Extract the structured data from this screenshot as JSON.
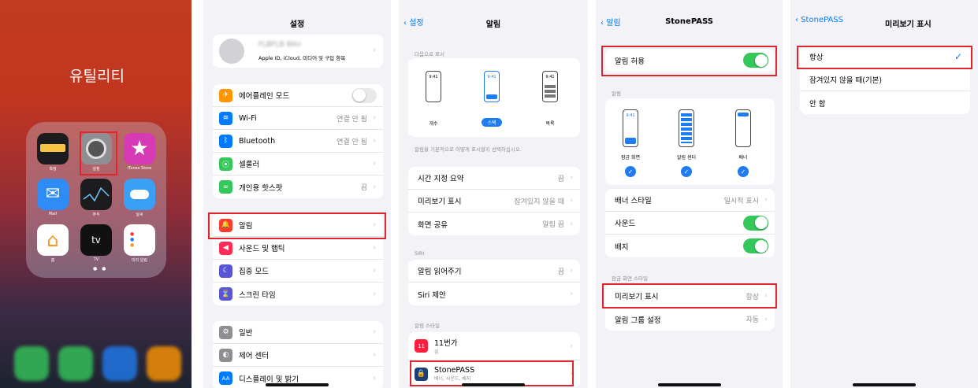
{
  "home": {
    "folder_title": "유틸리티",
    "apps": [
      "측정",
      "설정",
      "iTunes Store",
      "Mail",
      "주식",
      "날씨",
      "홈",
      "TV",
      "미리 알림"
    ],
    "tv_text": "tv"
  },
  "settings": {
    "title": "설정",
    "account_name": "FLBFLB BIIU",
    "account_sub": "Apple ID, iCloud, 미디어 및 구입 항목",
    "group1": [
      {
        "label": "에어플레인 모드",
        "value": ""
      },
      {
        "label": "Wi-Fi",
        "value": "연결 안 됨"
      },
      {
        "label": "Bluetooth",
        "value": "연결 안 됨"
      },
      {
        "label": "셀룰러",
        "value": ""
      },
      {
        "label": "개인용 핫스팟",
        "value": "끔"
      }
    ],
    "group2": [
      {
        "label": "알림"
      },
      {
        "label": "사운드 및 햅틱"
      },
      {
        "label": "집중 모드"
      },
      {
        "label": "스크린 타임"
      }
    ],
    "group3": [
      {
        "label": "일반"
      },
      {
        "label": "제어 센터"
      },
      {
        "label": "디스플레이 및 밝기"
      }
    ]
  },
  "notifications": {
    "back": "설정",
    "title": "알림",
    "section_display": "다음으로 표시",
    "styles": [
      "개수",
      "스택",
      "목록"
    ],
    "time": "9:41",
    "desc": "알림을 기본적으로 어떻게 표시할지 선택하십시오.",
    "rows": [
      {
        "label": "시간 지정 요약",
        "value": "끔"
      },
      {
        "label": "미리보기 표시",
        "value": "잠겨있지 않을 때"
      },
      {
        "label": "화면 공유",
        "value": "알림 끔"
      }
    ],
    "siri_header": "SIRI",
    "siri_rows": [
      {
        "label": "알림 읽어주기",
        "value": "끔"
      },
      {
        "label": "Siri 제안",
        "value": ""
      }
    ],
    "style_header": "알림 스타일",
    "apps": [
      {
        "name": "11번가",
        "sub": "끔",
        "icon": "11"
      },
      {
        "name": "StonePASS",
        "sub": "배너, 사운드, 배지"
      }
    ]
  },
  "stonepass": {
    "back": "알림",
    "title": "StonePASS",
    "allow": "알림 허용",
    "alert_header": "알림",
    "positions": [
      "잠금 화면",
      "알림 센터",
      "배너"
    ],
    "time": "9:41",
    "rows": [
      {
        "label": "배너 스타일",
        "value": "일시적 표시"
      },
      {
        "label": "사운드",
        "value": ""
      },
      {
        "label": "배지",
        "value": ""
      }
    ],
    "lock_header": "잠금 화면 스타일",
    "lock_rows": [
      {
        "label": "미리보기 표시",
        "value": "항상"
      },
      {
        "label": "알림 그룹 설정",
        "value": "자동"
      }
    ]
  },
  "preview": {
    "back": "StonePASS",
    "title": "미리보기 표시",
    "options": [
      "항상",
      "잠겨있지 않을 때(기본)",
      "안 함"
    ]
  }
}
